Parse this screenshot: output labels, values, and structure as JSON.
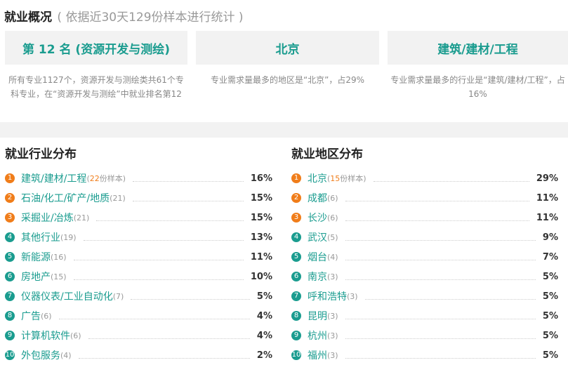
{
  "header": {
    "title": "就业概况",
    "subtitle": "( 依据近30天129份样本进行统计 )"
  },
  "cards": [
    {
      "title": "第 12 名 (资源开发与测绘)",
      "desc": "所有专业1127个，资源开发与测绘类共61个专科专业，在“资源开发与测绘”中就业排名第12"
    },
    {
      "title": "北京",
      "desc": "专业需求量最多的地区是“北京”，占29%"
    },
    {
      "title": "建筑/建材/工程",
      "desc": "专业需求量最多的行业是“建筑/建材/工程”，占16%"
    }
  ],
  "industry": {
    "heading": "就业行业分布",
    "items": [
      {
        "rank": "1",
        "name": "建筑/建材/工程",
        "count": "22",
        "suffix": "份样本",
        "pct": "16%"
      },
      {
        "rank": "2",
        "name": "石油/化工/矿产/地质",
        "count": "(21)",
        "pct": "15%"
      },
      {
        "rank": "3",
        "name": "采掘业/冶炼",
        "count": "(21)",
        "pct": "15%"
      },
      {
        "rank": "4",
        "name": "其他行业",
        "count": "(19)",
        "pct": "13%"
      },
      {
        "rank": "5",
        "name": "新能源",
        "count": "(16)",
        "pct": "11%"
      },
      {
        "rank": "6",
        "name": "房地产",
        "count": "(15)",
        "pct": "10%"
      },
      {
        "rank": "7",
        "name": "仪器仪表/工业自动化",
        "count": "(7)",
        "pct": "5%"
      },
      {
        "rank": "8",
        "name": "广告",
        "count": "(6)",
        "pct": "4%"
      },
      {
        "rank": "9",
        "name": "计算机软件",
        "count": "(6)",
        "pct": "4%"
      },
      {
        "rank": "10",
        "name": "外包服务",
        "count": "(4)",
        "pct": "2%"
      }
    ]
  },
  "region": {
    "heading": "就业地区分布",
    "items": [
      {
        "rank": "1",
        "name": "北京",
        "count": "15",
        "suffix": "份样本",
        "pct": "29%"
      },
      {
        "rank": "2",
        "name": "成都",
        "count": "(6)",
        "pct": "11%"
      },
      {
        "rank": "3",
        "name": "长沙",
        "count": "(6)",
        "pct": "11%"
      },
      {
        "rank": "4",
        "name": "武汉",
        "count": "(5)",
        "pct": "9%"
      },
      {
        "rank": "5",
        "name": "烟台",
        "count": "(4)",
        "pct": "7%"
      },
      {
        "rank": "6",
        "name": "南京",
        "count": "(3)",
        "pct": "5%"
      },
      {
        "rank": "7",
        "name": "呼和浩特",
        "count": "(3)",
        "pct": "5%"
      },
      {
        "rank": "8",
        "name": "昆明",
        "count": "(3)",
        "pct": "5%"
      },
      {
        "rank": "9",
        "name": "杭州",
        "count": "(3)",
        "pct": "5%"
      },
      {
        "rank": "10",
        "name": "福州",
        "count": "(3)",
        "pct": "5%"
      }
    ]
  },
  "colors": {
    "accent": "#1a9c8f",
    "hot": "#f07d1a",
    "muted": "#999999",
    "panel": "#f2f2f2"
  }
}
